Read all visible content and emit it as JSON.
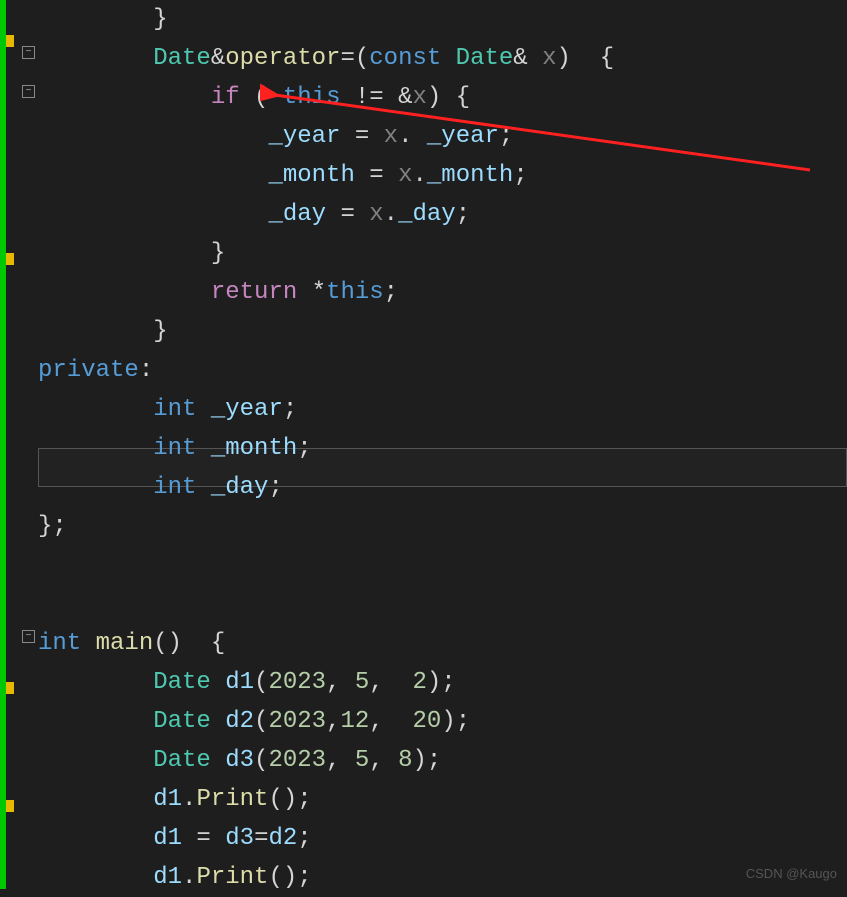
{
  "watermark": "CSDN @Kaugo",
  "code": {
    "l0": "        }",
    "l1_a": "        ",
    "l1_type": "Date",
    "l1_amp": "&",
    "l1_op": "operator",
    "l1_eq": "=(",
    "l1_const": "const",
    "l1_type2": " Date",
    "l1_amp2": "&",
    "l1_x": " x",
    "l1_end": ")  {",
    "l2_a": "            ",
    "l2_if": "if",
    "l2_b": " ( ",
    "l2_this": "this",
    "l2_c": " != &",
    "l2_x": "x",
    "l2_d": ") {",
    "l3_a": "                ",
    "l3_y": "_year",
    "l3_b": " = ",
    "l3_x": "x",
    "l3_c": ". ",
    "l3_y2": "_year",
    "l3_d": ";",
    "l4_a": "                ",
    "l4_m": "_month",
    "l4_b": " = ",
    "l4_x": "x",
    "l4_c": ".",
    "l4_m2": "_month",
    "l4_d": ";",
    "l5_a": "                ",
    "l5_d": "_day",
    "l5_b": " = ",
    "l5_x": "x",
    "l5_c": ".",
    "l5_d2": "_day",
    "l5_e": ";",
    "l6": "            }",
    "l7_a": "            ",
    "l7_ret": "return",
    "l7_b": " *",
    "l7_this": "this",
    "l7_c": ";",
    "l8": "        }",
    "l9_a": "",
    "l9_priv": "private",
    "l9_b": ":",
    "l10_a": "        ",
    "l10_int": "int",
    "l10_b": " ",
    "l10_y": "_year",
    "l10_c": ";",
    "l11_a": "        ",
    "l11_int": "int",
    "l11_b": " ",
    "l11_m": "_month",
    "l11_c": ";",
    "l12_a": "        ",
    "l12_int": "int",
    "l12_b": " ",
    "l12_d": "_day",
    "l12_c": ";",
    "l13": "};",
    "l14": "",
    "l15": "",
    "l16_int": "int",
    "l16_b": " ",
    "l16_main": "main",
    "l16_c": "()  {",
    "l17_a": "        ",
    "l17_type": "Date",
    "l17_b": " ",
    "l17_d1": "d1",
    "l17_c": "(",
    "l17_n1": "2023",
    "l17_d": ", ",
    "l17_n2": "5",
    "l17_e": ",  ",
    "l17_n3": "2",
    "l17_f": ");",
    "l18_a": "        ",
    "l18_type": "Date",
    "l18_b": " ",
    "l18_d2": "d2",
    "l18_c": "(",
    "l18_n1": "2023",
    "l18_d": ",",
    "l18_n2": "12",
    "l18_e": ",  ",
    "l18_n3": "20",
    "l18_f": ");",
    "l19_a": "        ",
    "l19_type": "Date",
    "l19_b": " ",
    "l19_d3": "d3",
    "l19_c": "(",
    "l19_n1": "2023",
    "l19_d": ", ",
    "l19_n2": "5",
    "l19_e": ", ",
    "l19_n3": "8",
    "l19_f": ");",
    "l20_a": "        ",
    "l20_d1": "d1",
    "l20_b": ".",
    "l20_print": "Print",
    "l20_c": "();",
    "l21_a": "        ",
    "l21_d1": "d1",
    "l21_b": " = ",
    "l21_d3": "d3",
    "l21_c": "=",
    "l21_d2": "d2",
    "l21_d": ";",
    "l22_a": "        ",
    "l22_d1": "d1",
    "l22_b": ".",
    "l22_print": "Print",
    "l22_c": "();"
  }
}
